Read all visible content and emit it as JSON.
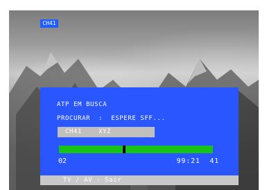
{
  "channel_badge": "CH41",
  "osd": {
    "title": "ATP EM BUSCA",
    "status": "PROCURAR  :  ESPERE SFF...",
    "channel_name": "CH41    XYZ",
    "progress": 0.42,
    "left_value": "02",
    "right_value": "99:21  41",
    "footer": "TV / AV : Sair"
  },
  "colors": {
    "panel": "#2a56ff",
    "badge": "#1f5dff",
    "progress": "#18c318",
    "channel_box": "#bfbfbf",
    "footer": "#c8c8c8"
  }
}
